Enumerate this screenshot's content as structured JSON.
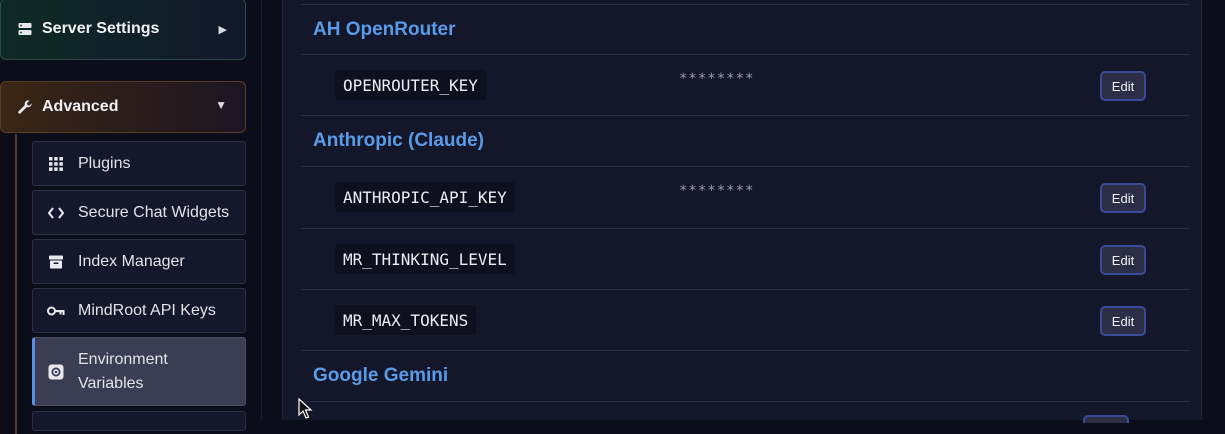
{
  "sidebar": {
    "server_settings": {
      "label": "Server Settings",
      "icon": "server-icon",
      "arrow": "▶"
    },
    "advanced": {
      "label": "Advanced",
      "icon": "wrench-icon",
      "arrow": "▼"
    },
    "items": [
      {
        "label": "Plugins",
        "icon": "grid-icon"
      },
      {
        "label": "Secure Chat Widgets",
        "icon": "code-icon"
      },
      {
        "label": "Index Manager",
        "icon": "archive-icon"
      },
      {
        "label": "MindRoot API Keys",
        "icon": "key-icon"
      },
      {
        "label": "Environment Variables",
        "icon": "gear-box-icon",
        "active": true
      }
    ]
  },
  "main": {
    "providers": [
      {
        "name": "AH OpenRouter",
        "vars": [
          {
            "name": "OPENROUTER_KEY",
            "value": "********",
            "edit_label": "Edit"
          }
        ]
      },
      {
        "name": "Anthropic (Claude)",
        "vars": [
          {
            "name": "ANTHROPIC_API_KEY",
            "value": "********",
            "edit_label": "Edit"
          },
          {
            "name": "MR_THINKING_LEVEL",
            "value": "",
            "edit_label": "Edit"
          },
          {
            "name": "MR_MAX_TOKENS",
            "value": "",
            "edit_label": "Edit"
          }
        ]
      },
      {
        "name": "Google Gemini",
        "vars": []
      }
    ]
  },
  "colors": {
    "accent": "#5a9be8",
    "active_border": "#5a8ee0",
    "edit_border": "#3a4a9a"
  }
}
